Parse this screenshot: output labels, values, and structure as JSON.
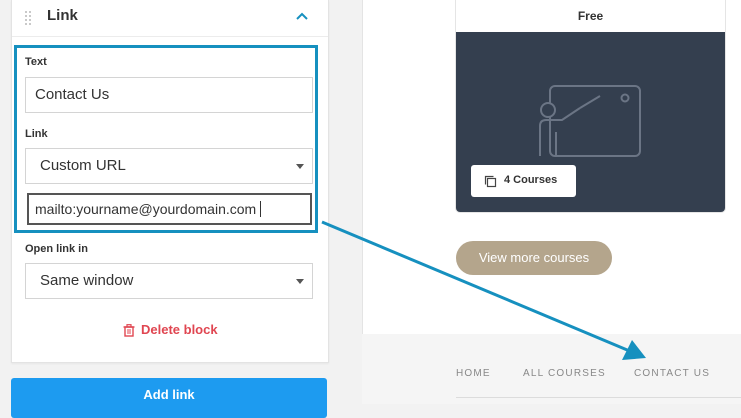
{
  "panel": {
    "title": "Link",
    "text_label": "Text",
    "text_value": "Contact Us",
    "link_label": "Link",
    "link_type": "Custom URL",
    "url_value": "mailto:yourname@yourdomain.com",
    "open_label": "Open link in",
    "open_value": "Same window",
    "delete_label": "Delete block",
    "add_link_label": "Add link"
  },
  "preview": {
    "price": "Free",
    "course_count": "4 Courses",
    "view_more": "View more courses",
    "nav": [
      "HOME",
      "ALL COURSES",
      "CONTACT US"
    ]
  },
  "colors": {
    "highlight": "#1690bf",
    "delete": "#e04651",
    "add_link": "#1d9bf0",
    "view_more": "#b4a58c",
    "card_image": "#343f4f"
  }
}
